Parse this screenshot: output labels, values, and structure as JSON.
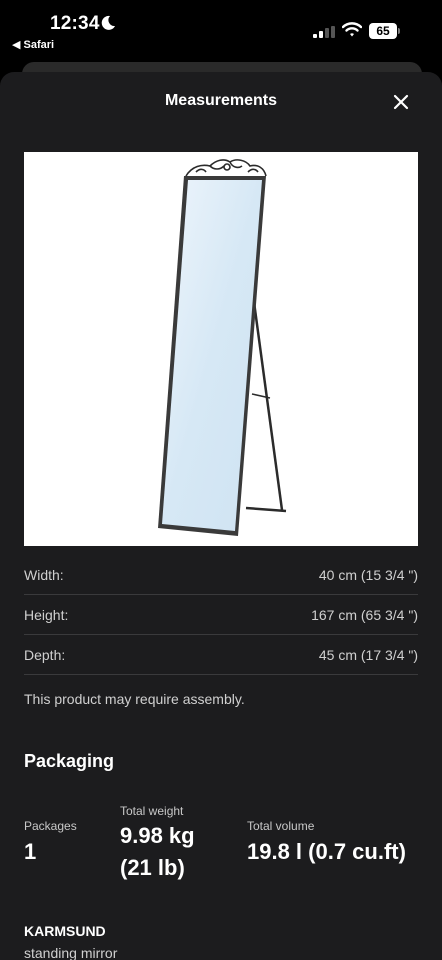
{
  "status_bar": {
    "time": "12:34",
    "back_app": "◀ Safari",
    "battery": "65"
  },
  "sheet": {
    "title": "Measurements",
    "close_label": "×"
  },
  "image": {
    "alt": "KARMSUND standing mirror"
  },
  "dimensions": [
    {
      "label": "Width:",
      "value": "40 cm (15 3/4 \")"
    },
    {
      "label": "Height:",
      "value": "167 cm (65 3/4 \")"
    },
    {
      "label": "Depth:",
      "value": "45 cm (17 3/4 \")"
    }
  ],
  "assembly_note": "This product may require assembly.",
  "packaging": {
    "title": "Packaging",
    "packages_label": "Packages",
    "packages_value": "1",
    "weight_label": "Total weight",
    "weight_value_line1": "9.98 kg",
    "weight_value_line2": "(21 lb)",
    "volume_label": "Total volume",
    "volume_value": "19.8 l (0.7 cu.ft)"
  },
  "product": {
    "name": "KARMSUND",
    "description": "standing mirror"
  },
  "colors": {
    "sheet_bg": "#1c1c1e",
    "divider": "#3a3a3c"
  }
}
